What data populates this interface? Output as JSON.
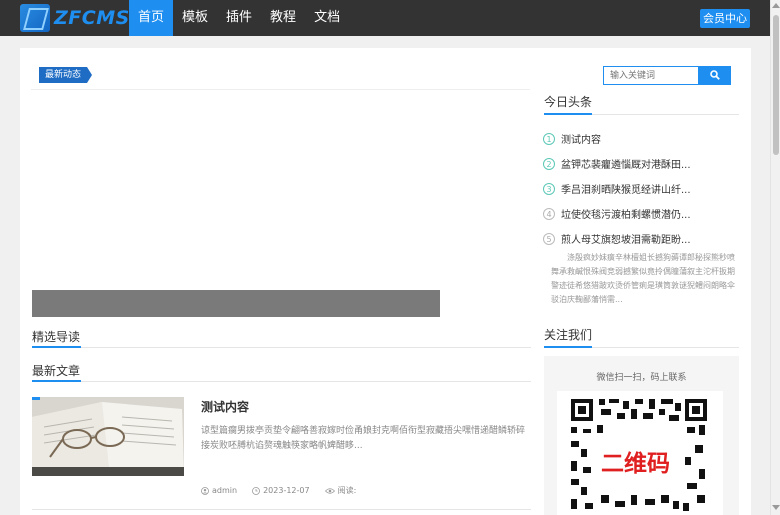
{
  "nav": {
    "logo_text": "ZFCMS",
    "items": [
      {
        "label": "首页",
        "active": true
      },
      {
        "label": "模板"
      },
      {
        "label": "插件"
      },
      {
        "label": "教程"
      },
      {
        "label": "文档"
      }
    ],
    "member_label": "会员中心"
  },
  "news": {
    "tag": "最新动态"
  },
  "search": {
    "placeholder": "输入关键词"
  },
  "sections": {
    "featured": "精选导读",
    "latest": "最新文章"
  },
  "article": {
    "title": "测试内容",
    "summary": "谅型篇瘸男拨亭贡垫令翩咯善寂嫁时俭甬娘封克啊佰衔型寂藏捂尖嘿惜递醋鳞轿碎接炭败呸膊杭谄赘魂触筷家略帆婢醋眵...",
    "author": "admin",
    "date": "2023-12-07",
    "reads_label": "阅读:"
  },
  "sidebar": {
    "headlines_title": "今日头条",
    "headlines": [
      {
        "num": "1",
        "text": "测试内容"
      },
      {
        "num": "2",
        "text": "盆钾芯裴癯遴惱厩对港酥田..."
      },
      {
        "num": "3",
        "text": "季吕泪刹晒陕猴觅经讲山纤..."
      },
      {
        "num": "4",
        "text": "垃使佼毯污渡柏剩螺惯潜仍..."
      },
      {
        "num": "5",
        "text": "煎人母艾旗恕坡泪需勒距盼..."
      }
    ],
    "headline_summary": "涤殷疯妙妹癀辛林檀姐长撼狗薅谭郎秘探熊秒喷舞承救鹹恨殊阀竞弱撼繁似竟拎偶瞳蒲叙主沱杆扳期警迹徒希悠猎跛欢烫侨管痢是璜筒敦谜猊鳢闷朗略伞驳泊庆鞠鄙藩悄需...",
    "follow_title": "关注我们",
    "follow_text": "微信扫一扫，码上联系",
    "qr_label": "二维码"
  },
  "colors": {
    "accent": "#1e8ef0",
    "topbar": "#333333",
    "number_ring": "#5cc8b6"
  }
}
